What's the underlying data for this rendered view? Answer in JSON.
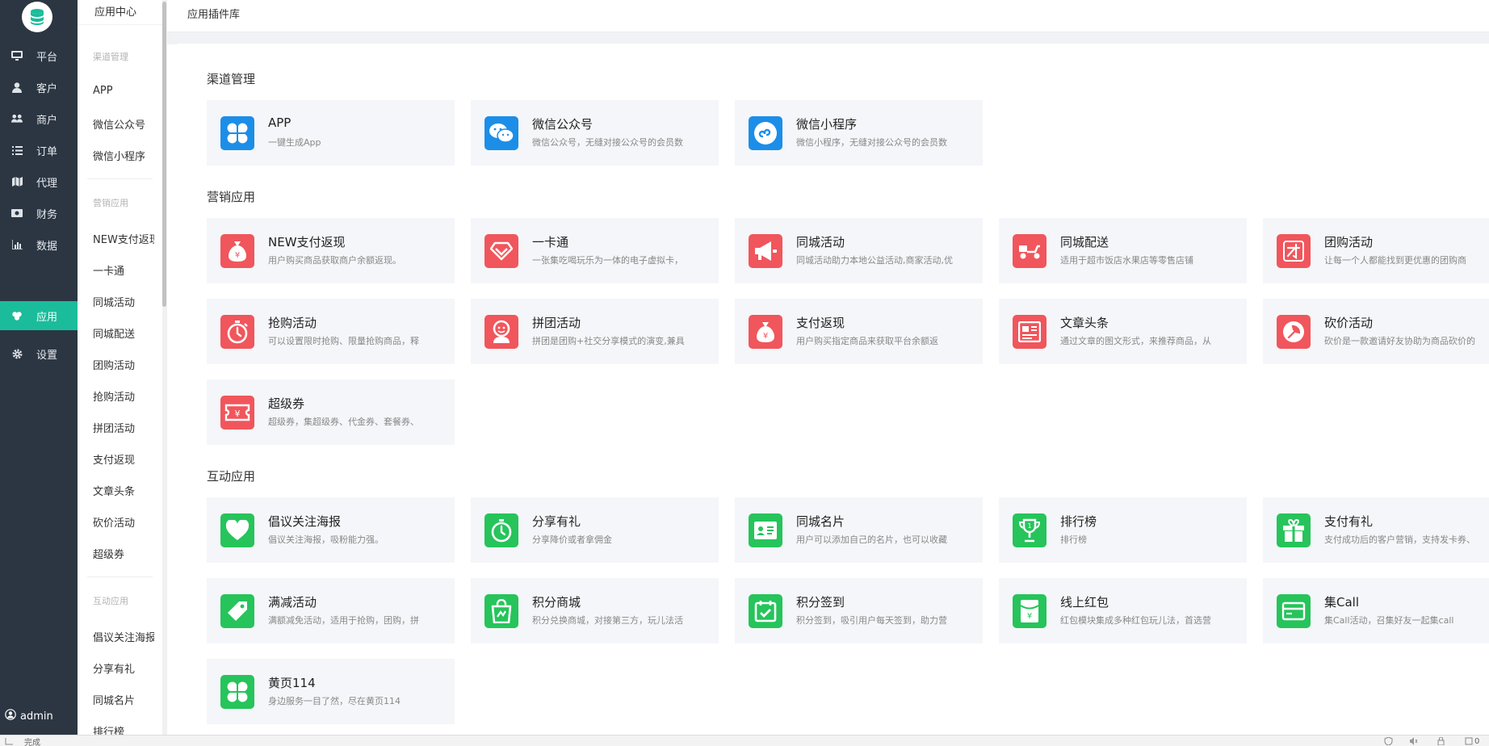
{
  "nav": {
    "items": [
      {
        "label": "平台",
        "icon": "monitor-icon"
      },
      {
        "label": "客户",
        "icon": "user-icon"
      },
      {
        "label": "商户",
        "icon": "users-icon"
      },
      {
        "label": "订单",
        "icon": "list-icon"
      },
      {
        "label": "代理",
        "icon": "map-icon"
      },
      {
        "label": "财务",
        "icon": "money-icon"
      },
      {
        "label": "数据",
        "icon": "bar-chart-icon"
      },
      {
        "label": "应用",
        "icon": "apps-icon",
        "active": true
      },
      {
        "label": "设置",
        "icon": "gear-icon"
      }
    ],
    "user": "admin"
  },
  "subnav": {
    "header": "应用中心",
    "group1_title": "渠道管理",
    "group1": [
      "APP",
      "微信公众号",
      "微信小程序"
    ],
    "group2_title": "营销应用",
    "group2": [
      "NEW支付返现",
      "一卡通",
      "同城活动",
      "同城配送",
      "团购活动",
      "抢购活动",
      "拼团活动",
      "支付返现",
      "文章头条",
      "砍价活动",
      "超级券"
    ],
    "group3_title": "互动应用",
    "group3": [
      "倡议关注海报",
      "分享有礼",
      "同城名片",
      "排行榜"
    ]
  },
  "breadcrumb": "应用插件库",
  "sections": {
    "channel": "渠道管理",
    "marketing": "营销应用",
    "interactive": "互动应用"
  },
  "channel_cards": [
    {
      "title": "APP",
      "desc": "一键生成App",
      "icon": "clover-icon"
    },
    {
      "title": "微信公众号",
      "desc": "微信公众号，无缝对接公众号的会员数",
      "icon": "wechat-icon"
    },
    {
      "title": "微信小程序",
      "desc": "微信小程序，无缝对接公众号的会员数",
      "icon": "mini-program-icon"
    }
  ],
  "marketing_cards": [
    {
      "title": "NEW支付返现",
      "desc": "用户购买商品获取商户余额返现。",
      "icon": "money-bag-icon"
    },
    {
      "title": "一卡通",
      "desc": "一张集吃喝玩乐为一体的电子虚拟卡，",
      "icon": "diamond-icon"
    },
    {
      "title": "同城活动",
      "desc": "同城活动助力本地公益活动,商家活动,优",
      "icon": "megaphone-icon"
    },
    {
      "title": "同城配送",
      "desc": "适用于超市饭店水果店等零售店铺",
      "icon": "scooter-icon"
    },
    {
      "title": "团购活动",
      "desc": "让每一个人都能找到更优惠的团购商",
      "icon": "group-buy-icon"
    },
    {
      "title": "抢购活动",
      "desc": "可以设置限时抢购、限量抢购商品，释",
      "icon": "stopwatch-icon"
    },
    {
      "title": "拼团活动",
      "desc": "拼团是团购+社交分享模式的演变,兼具",
      "icon": "person-icon"
    },
    {
      "title": "支付返现",
      "desc": "用户购买指定商品来获取平台余额返",
      "icon": "money-bag-icon"
    },
    {
      "title": "文章头条",
      "desc": "通过文章的图文形式，来推荐商品，从",
      "icon": "article-icon"
    },
    {
      "title": "砍价活动",
      "desc": "砍价是一款邀请好友协助为商品砍价的",
      "icon": "axe-icon"
    },
    {
      "title": "超级券",
      "desc": "超级券，集超级券、代金券、套餐券、",
      "icon": "coupon-icon"
    }
  ],
  "interactive_cards": [
    {
      "title": "倡议关注海报",
      "desc": "倡议关注海报，吸粉能力强。",
      "icon": "heart-icon"
    },
    {
      "title": "分享有礼",
      "desc": "分享降价或者拿佣金",
      "icon": "share-icon"
    },
    {
      "title": "同城名片",
      "desc": "用户可以添加自己的名片，也可以收藏",
      "icon": "id-card-icon"
    },
    {
      "title": "排行榜",
      "desc": "排行榜",
      "icon": "trophy-icon"
    },
    {
      "title": "支付有礼",
      "desc": "支付成功后的客户营销，支持发卡券、",
      "icon": "gift-icon"
    },
    {
      "title": "满减活动",
      "desc": "满额减免活动，适用于抢购，团购，拼",
      "icon": "tag-icon"
    },
    {
      "title": "积分商城",
      "desc": "积分兑换商城，对接第三方，玩儿法活",
      "icon": "shopping-bag-icon"
    },
    {
      "title": "积分签到",
      "desc": "积分签到，吸引用户每天签到，助力营",
      "icon": "calendar-check-icon"
    },
    {
      "title": "线上红包",
      "desc": "红包模块集成多种红包玩儿法，首选营",
      "icon": "red-packet-icon"
    },
    {
      "title": "集Call",
      "desc": "集Call活动，召集好友一起集call",
      "icon": "card-icon"
    },
    {
      "title": "黄页114",
      "desc": "身边服务一目了然，尽在黄页114",
      "icon": "clover-icon"
    }
  ],
  "statusbar": {
    "text": "完成",
    "zoom": "0"
  },
  "colors": {
    "nav_bg": "#2c3643",
    "active": "#1bbc9b",
    "blue": "#1c8ee8",
    "red": "#f0565c",
    "green": "#26c45b",
    "card_bg": "#f5f6f9"
  }
}
